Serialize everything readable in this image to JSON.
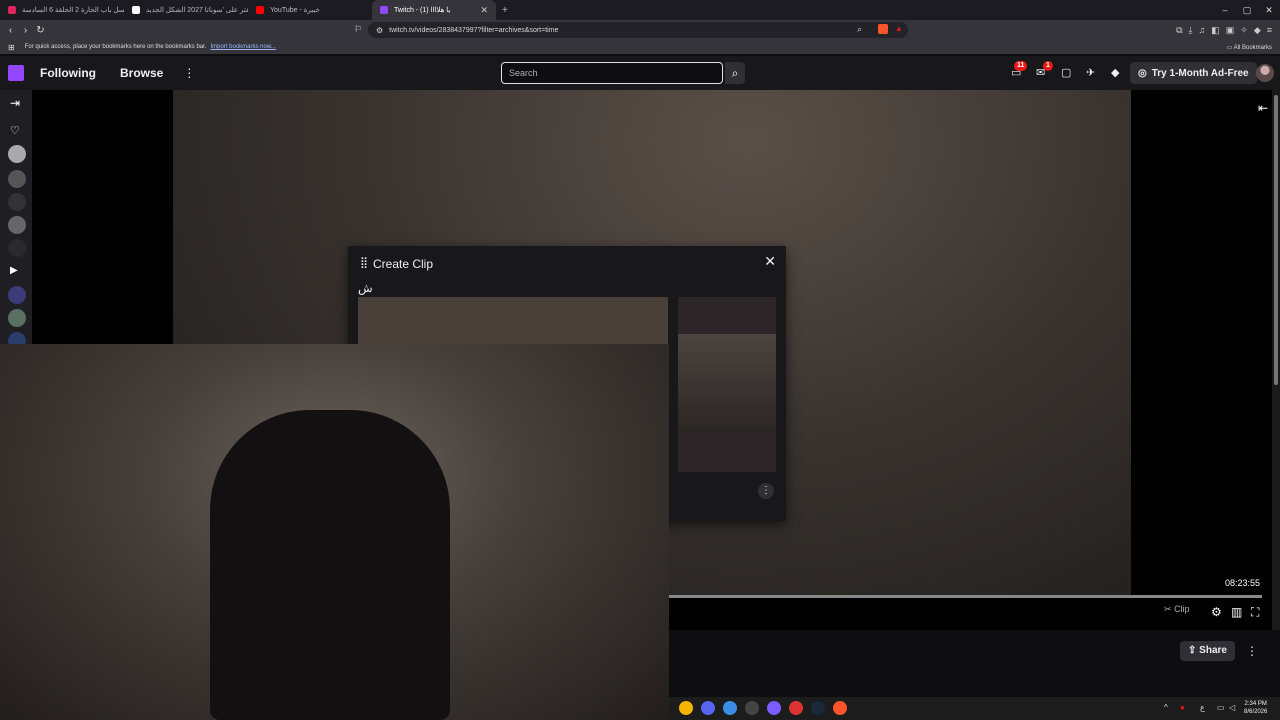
{
  "browser": {
    "tabs": [
      {
        "title": "مسلسل باب الحارة 2 الحلقة 6 السادسة",
        "fav_color": "#e0245e"
      },
      {
        "title": "اعتر على 'سوناتا 2027 الشكل الجديد'",
        "fav_color": "#ffffff"
      },
      {
        "title": "YouTube - خبيرة",
        "fav_color": "#ff0000"
      },
      {
        "title": "Twitch - (1) يا هلاااا",
        "fav_color": "#9147ff",
        "active": true
      }
    ],
    "url": "twitch.tv/videos/2838437997?filter=archives&sort=time",
    "bookmarks_msg": "For quick access, place your bookmarks here on the bookmarks bar.",
    "import_link": "Import bookmarks now...",
    "all_bookmarks": "All Bookmarks"
  },
  "twitch": {
    "nav": {
      "following": "Following",
      "browse": "Browse"
    },
    "search_placeholder": "Search",
    "notifications_count": "11",
    "inbox_count": "1",
    "adfree": "Try 1-Month Ad-Free"
  },
  "clip_modal": {
    "title": "Create Clip",
    "subtitle": "ش"
  },
  "player": {
    "time": "08:23:55",
    "clip_label": "Clip",
    "share_label": "Share"
  },
  "taskbar": {
    "time": "2:34 PM",
    "date": "8/6/2026",
    "lang": "ع"
  }
}
